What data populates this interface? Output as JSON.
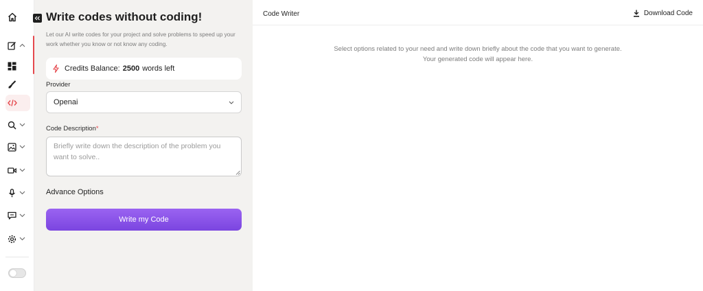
{
  "sidebar": {
    "icons": [
      {
        "name": "home-icon",
        "has_chevron": false
      },
      {
        "name": "edit-icon",
        "has_chevron": true,
        "chevron": "up"
      },
      {
        "name": "dashboard-icon",
        "has_chevron": false
      },
      {
        "name": "brush-icon",
        "has_chevron": false
      },
      {
        "name": "code-icon",
        "has_chevron": false,
        "active": true
      },
      {
        "name": "search-icon",
        "has_chevron": true,
        "chevron": "down"
      },
      {
        "name": "image-icon",
        "has_chevron": true,
        "chevron": "down"
      },
      {
        "name": "video-icon",
        "has_chevron": true,
        "chevron": "down"
      },
      {
        "name": "microphone-icon",
        "has_chevron": true,
        "chevron": "down"
      },
      {
        "name": "chat-icon",
        "has_chevron": true,
        "chevron": "down"
      },
      {
        "name": "settings-icon",
        "has_chevron": true,
        "chevron": "down"
      },
      {
        "name": "theme-toggle",
        "has_chevron": false
      }
    ]
  },
  "form": {
    "title": "Write codes without coding!",
    "description": "Let our AI write codes for your project and solve problems to speed up your work whether you know or not know any coding.",
    "credits": {
      "label": "Credits Balance:",
      "amount": "2500",
      "suffix": "words left"
    },
    "provider": {
      "label": "Provider",
      "value": "Openai"
    },
    "code_description": {
      "label": "Code Description",
      "required_mark": "*",
      "placeholder": "Briefly write down the description of the problem you want to solve.."
    },
    "advance_options": "Advance Options",
    "submit_label": "Write my Code"
  },
  "output": {
    "title": "Code Writer",
    "download_label": "Download Code",
    "empty_message": "Select options related to your need and write down briefly about the code that you want to generate. Your generated code will appear here."
  },
  "colors": {
    "accent_purple": "#8a55ea",
    "active_red": "#e5484d",
    "panel_bg": "#f3f2f0"
  }
}
